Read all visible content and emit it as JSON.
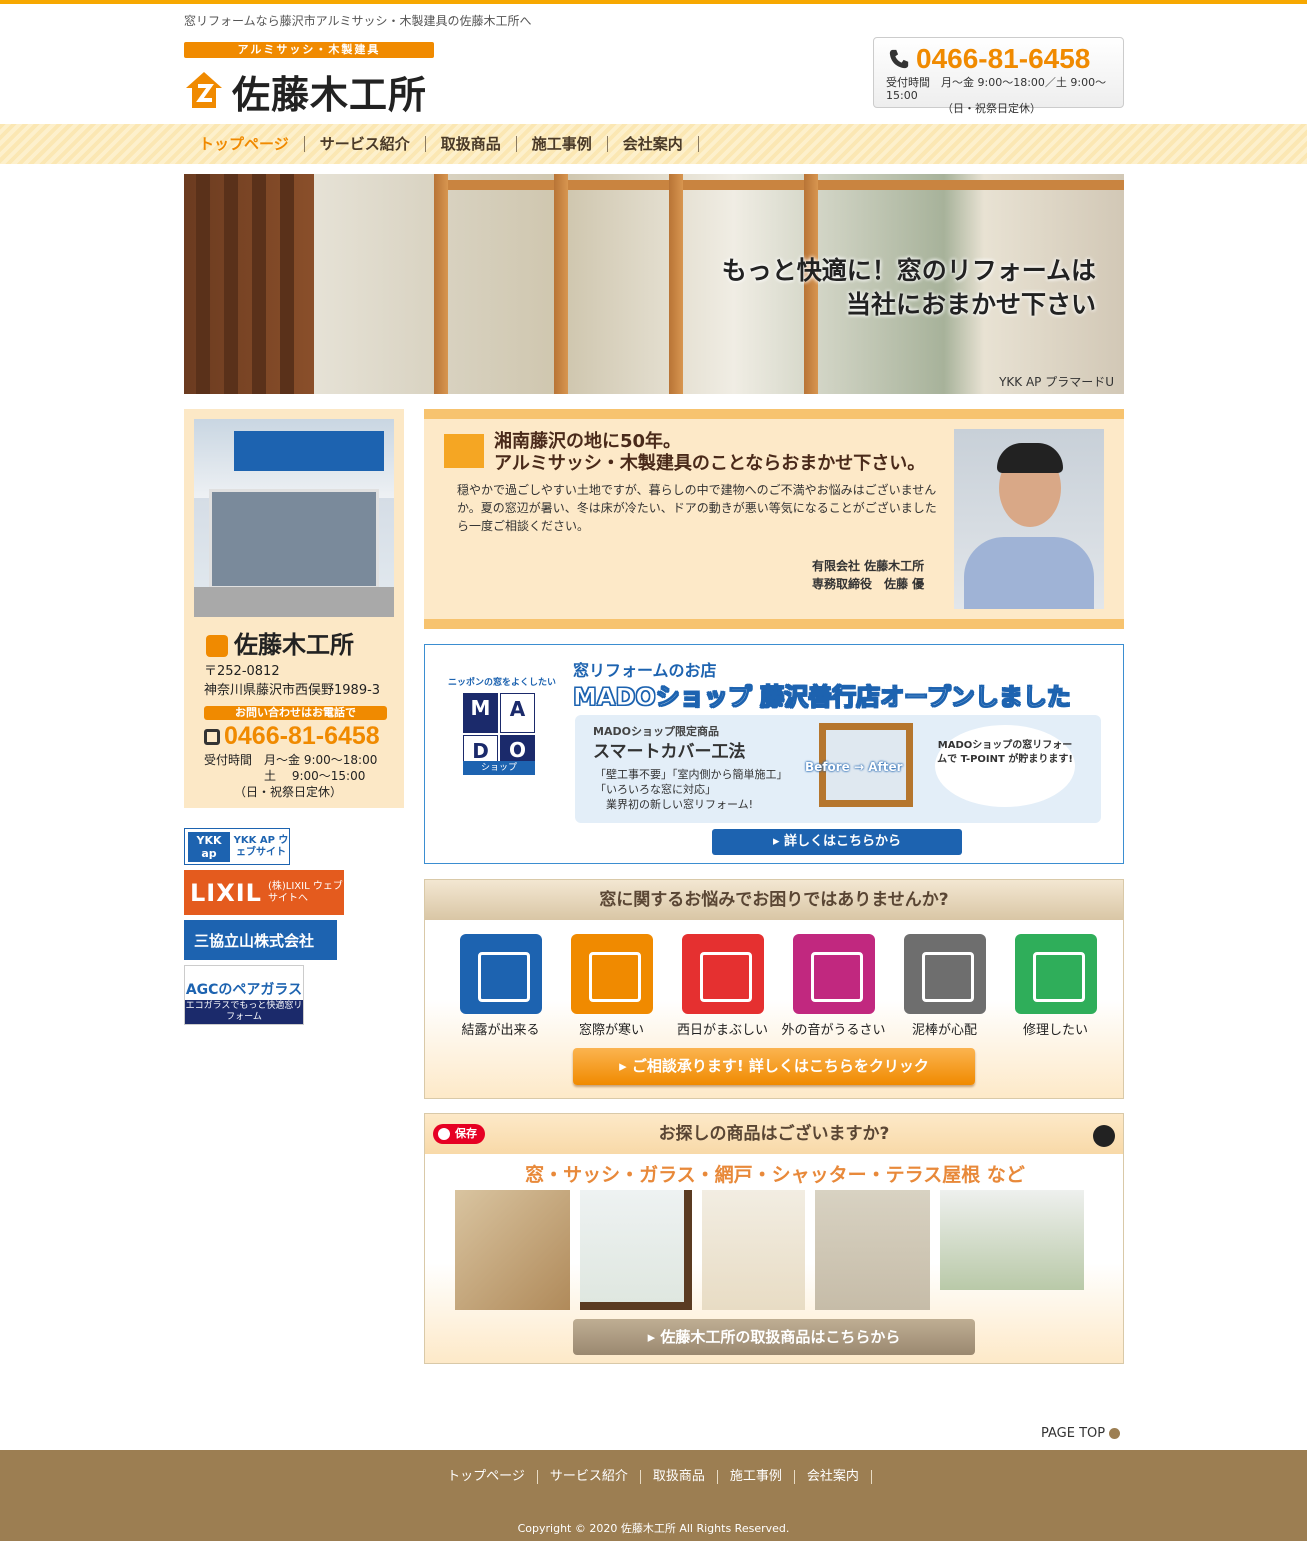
{
  "header": {
    "tagline": "窓リフォームなら藤沢市アルミサッシ・木製建具の佐藤木工所へ",
    "logo_band": "アルミサッシ・木製建具",
    "logo_name": "佐藤木工所",
    "phone": "0466-81-6458",
    "hours_line1": "受付時間　月～金 9:00～18:00／土 9:00～15:00",
    "hours_line2": "（日・祝祭日定休）"
  },
  "nav": [
    "トップページ",
    "サービス紹介",
    "取扱商品",
    "施工事例",
    "会社案内"
  ],
  "hero": {
    "catch_line1": "もっと快適に！窓のリフォームは",
    "catch_line2": "当社におまかせ下さい",
    "caption": "YKK AP プラマードU"
  },
  "sidebar": {
    "company": "佐藤木工所",
    "postal": "〒252-0812",
    "address": "神奈川県藤沢市西俣野1989-3",
    "contact_pill": "お問い合わせはお電話で",
    "phone": "0466-81-6458",
    "hours": "受付時間　月～金 9:00～18:00\n　　　　　土　 9:00～15:00\n　　　（日・祝祭日定休）",
    "banners": {
      "ykk_logo": "YKK ap",
      "ykk_text": "YKK AP ウェブサイト",
      "lixil_logo": "LIXIL",
      "lixil_text": "(株)LIXIL ウェブサイトへ",
      "sankyo": "三協立山株式会社",
      "agc_title": "AGCのペアガラス",
      "agc_sub": "エコガラスでもっと快適窓リフォーム"
    }
  },
  "greeting": {
    "title_line1": "湘南藤沢の地に50年。",
    "title_line2": "アルミサッシ・木製建具のことならおまかせ下さい。",
    "body": "穏やかで過ごしやすい土地ですが、暮らしの中で建物へのご不満やお悩みはございませんか。夏の窓辺が暑い、冬は床が冷たい、ドアの動きが悪い等気になることがございましたら一度ご相談ください。",
    "sign_line1": "有限会社 佐藤木工所",
    "sign_line2": "専務取締役　佐藤 優"
  },
  "mado": {
    "slogan": "ニッポンの窓をよくしたい",
    "logo_letters": [
      "M",
      "A",
      "D",
      "O"
    ],
    "shop_label": "ショップ",
    "title_small": "窓リフォームのお店",
    "title_big": "MADOショップ 藤沢善行店オープンしました",
    "limited": "MADOショップ限定商品",
    "product": "スマートカバー工法",
    "features": "「壁工事不要」「室内側から簡単施工」\n「いろいろな窓に対応」\n　業界初の新しい窓リフォーム!",
    "before_after": "Before → After",
    "bubble": "MADOショップの窓リフォームで T-POINT が貯まります!",
    "button": "▸ 詳しくはこちらから"
  },
  "worries": {
    "heading": "窓に関するお悩みでお困りではありませんか?",
    "items": [
      {
        "label": "結露が出来る",
        "color": "#1d63b0"
      },
      {
        "label": "窓際が寒い",
        "color": "#f08a00"
      },
      {
        "label": "西日がまぶしい",
        "color": "#e53030"
      },
      {
        "label": "外の音がうるさい",
        "color": "#c1287f"
      },
      {
        "label": "泥棒が心配",
        "color": "#6e6e6e"
      },
      {
        "label": "修理したい",
        "color": "#2fae5a"
      }
    ],
    "button": "▸ ご相談承ります! 詳しくはこちらをクリック"
  },
  "products": {
    "save": "保存",
    "heading": "お探しの商品はございますか?",
    "list": "窓・サッシ・ガラス・網戸・シャッター・テラス屋根 など",
    "button": "▸ 佐藤木工所の取扱商品はこちらから"
  },
  "pagetop": "PAGE TOP",
  "footer": {
    "nav": [
      "トップページ",
      "サービス紹介",
      "取扱商品",
      "施工事例",
      "会社案内"
    ],
    "copyright": "Copyright © 2020 佐藤木工所 All Rights Reserved."
  },
  "colors": {
    "accent": "#f08a00",
    "footer": "#9c7e52",
    "blue": "#1d63b0"
  }
}
